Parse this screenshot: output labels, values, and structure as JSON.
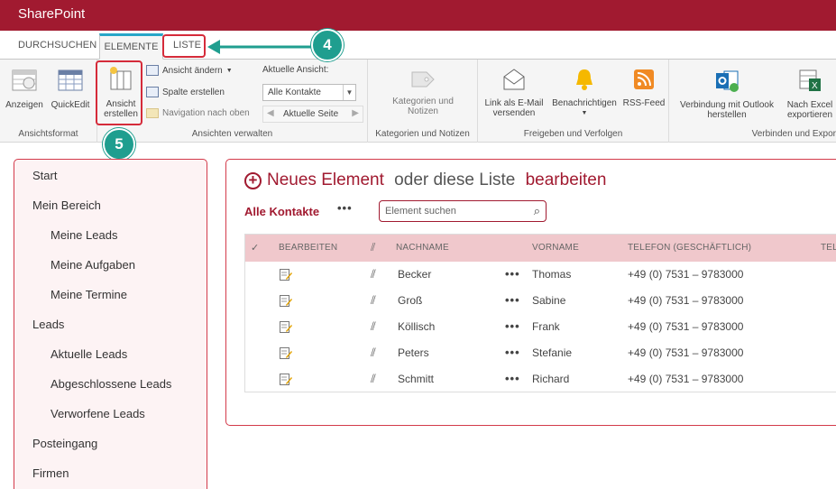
{
  "app": {
    "title": "SharePoint"
  },
  "tabs": [
    {
      "label": "DURCHSUCHEN"
    },
    {
      "label": "ELEMENTE"
    },
    {
      "label": "LISTE"
    }
  ],
  "ribbon": {
    "groups": {
      "ansichtsformat": {
        "label": "Ansichtsformat",
        "buttons": [
          {
            "label": "Anzeigen"
          },
          {
            "label": "QuickEdit"
          }
        ]
      },
      "ansichten": {
        "label": "Ansichten verwalten",
        "create_view": {
          "label_line1": "Ansicht",
          "label_line2": "erstellen"
        },
        "change_view": "Ansicht ändern",
        "create_column": "Spalte erstellen",
        "navigate_up": "Navigation nach oben",
        "current_view_label": "Aktuelle Ansicht:",
        "current_view_value": "Alle Kontakte",
        "current_page": "Aktuelle Seite"
      },
      "kategorien": {
        "label": "Kategorien und Notizen",
        "button_line1": "Kategorien und",
        "button_line2": "Notizen"
      },
      "freigeben": {
        "label": "Freigeben und Verfolgen",
        "email_line1": "Link als E-Mail",
        "email_line2": "versenden",
        "notify": "Benachrichtigen",
        "rss": "RSS-Feed"
      },
      "verbinden": {
        "label": "Verbinden und Expor",
        "outlook_line1": "Verbindung mit Outlook",
        "outlook_line2": "herstellen",
        "excel_line1": "Nach Excel",
        "excel_line2": "exportieren"
      }
    }
  },
  "annotations": {
    "badge4": "4",
    "badge5": "5"
  },
  "leftnav": {
    "items": [
      {
        "label": "Start"
      },
      {
        "label": "Mein Bereich"
      },
      {
        "label": "Meine Leads"
      },
      {
        "label": "Meine Aufgaben"
      },
      {
        "label": "Meine Termine"
      },
      {
        "label": "Leads"
      },
      {
        "label": "Aktuelle Leads"
      },
      {
        "label": "Abgeschlossene Leads"
      },
      {
        "label": "Verworfene Leads"
      },
      {
        "label": "Posteingang"
      },
      {
        "label": "Firmen"
      }
    ]
  },
  "main": {
    "new_item": {
      "part1": "Neues Element",
      "part2": " oder diese Liste ",
      "part3": "bearbeiten"
    },
    "view_name": "Alle Kontakte",
    "more": "•••",
    "search_placeholder": "Element suchen",
    "columns": {
      "check": "✓",
      "edit": "BEARBEITEN",
      "lastname": "NACHNAME",
      "firstname": "VORNAME",
      "phone": "TELEFON (GESCHÄFTLICH)",
      "extra": "TEL"
    },
    "rows": [
      {
        "lastname": "Becker",
        "firstname": "Thomas",
        "phone": "+49 (0) 7531 – 9783000"
      },
      {
        "lastname": "Groß",
        "firstname": "Sabine",
        "phone": "+49 (0) 7531 – 9783000"
      },
      {
        "lastname": "Köllisch",
        "firstname": "Frank",
        "phone": "+49 (0) 7531 – 9783000"
      },
      {
        "lastname": "Peters",
        "firstname": "Stefanie",
        "phone": "+49 (0) 7531 – 9783000"
      },
      {
        "lastname": "Schmitt",
        "firstname": "Richard",
        "phone": "+49 (0) 7531 – 9783000"
      }
    ]
  }
}
